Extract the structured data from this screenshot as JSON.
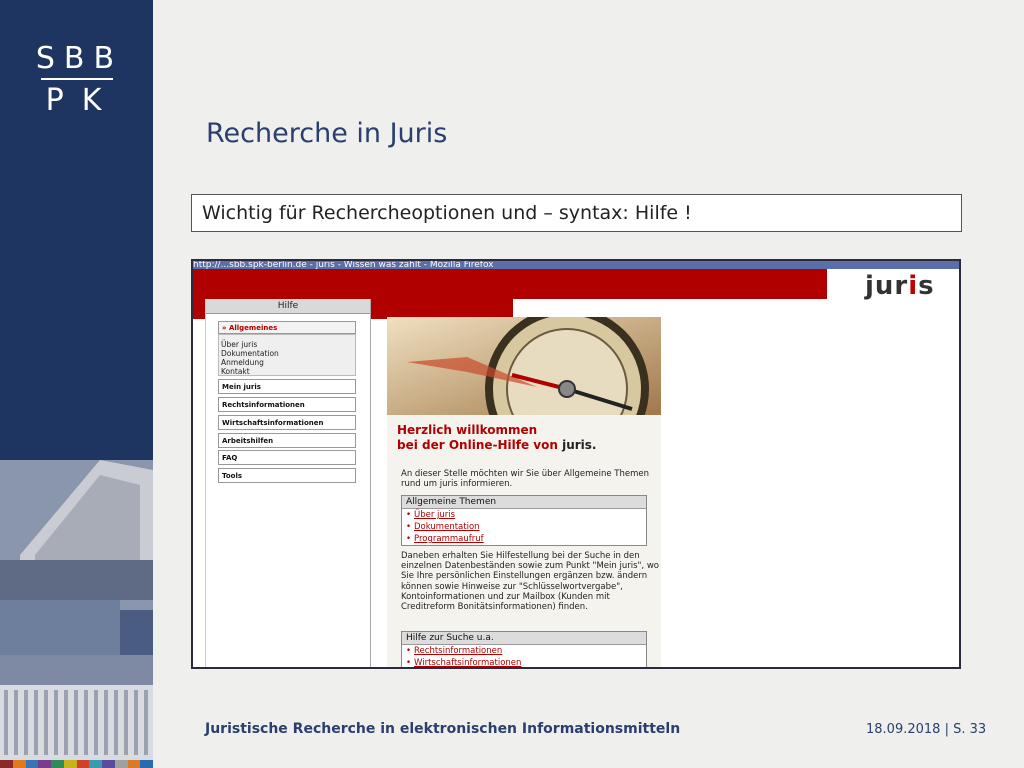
{
  "logo": {
    "line1": "SBB",
    "line2": "PK"
  },
  "slide": {
    "title": "Recherche in Juris",
    "info": "Wichtig für Rechercheoptionen und – syntax: Hilfe !"
  },
  "browser": {
    "title_bar": "http://...sbb.spk-berlin.de - juris - Wissen was zählt - Mozilla Firefox",
    "brand": "juris"
  },
  "help_nav": {
    "header": "Hilfe",
    "active_item": "» Allgemeines",
    "sub_items": [
      "Über juris",
      "Dokumentation",
      "Anmeldung",
      "Kontakt"
    ],
    "items": [
      "Mein juris",
      "Rechtsinformationen",
      "Wirtschaftsinformationen",
      "Arbeitshilfen",
      "FAQ",
      "Tools"
    ]
  },
  "welcome": {
    "line1": "Herzlich willkommen",
    "line2": "bei der Online-Hilfe von",
    "brand": "juris.",
    "intro": "An dieser Stelle möchten wir Sie über Allgemeine Themen rund um juris informieren.",
    "topics_head": "Allgemeine Themen",
    "topics": [
      "Über juris",
      "Dokumentation",
      "Programmaufruf"
    ],
    "more": "Daneben erhalten Sie Hilfestellung bei der Suche in den einzelnen Datenbeständen sowie zum Punkt \"Mein juris\", wo Sie Ihre persönlichen Einstellungen ergänzen bzw. ändern können sowie Hinweise zur \"Schlüsselwortvergabe\", Kontoinformationen und zur Mailbox (Kunden mit Creditreform Bonitätsinformationen) finden.",
    "search_head": "Hilfe zur Suche u.a.",
    "search_items": [
      "Rechtsinformationen",
      "Wirtschaftsinformationen"
    ]
  },
  "footer": {
    "left": "Juristische Recherche in elektronischen Informationsmitteln",
    "right": "18.09.2018 | S. 33"
  },
  "colors": {
    "sidebar": "#1f3561",
    "red": "#b00000",
    "title": "#2a3f6e"
  }
}
